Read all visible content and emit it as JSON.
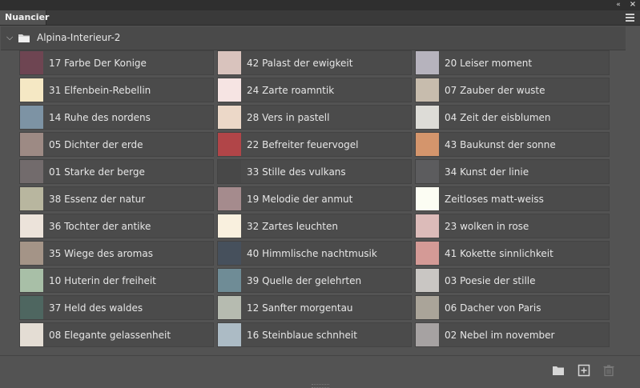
{
  "panel": {
    "tab_label": "Nuancier"
  },
  "group": {
    "name": "Alpina-Interieur-2"
  },
  "swatches": [
    [
      {
        "label": "17 Farbe Der Konige",
        "color": "#6e4552"
      },
      {
        "label": "42 Palast der ewigkeit",
        "color": "#d9c3bd"
      },
      {
        "label": "20 Leiser moment",
        "color": "#b6b3bd"
      }
    ],
    [
      {
        "label": "31 Elfenbein-Rebellin",
        "color": "#f5e8c4"
      },
      {
        "label": "24 Zarte roamntik",
        "color": "#f6e4e3"
      },
      {
        "label": "07 Zauber der wuste",
        "color": "#c7bcad"
      }
    ],
    [
      {
        "label": "14 Ruhe des nordens",
        "color": "#7d93a4"
      },
      {
        "label": "28 Vers in pastell",
        "color": "#ecd8c8"
      },
      {
        "label": "04 Zeit der eisblumen",
        "color": "#dddcd7"
      }
    ],
    [
      {
        "label": "05 Dichter der erde",
        "color": "#9d8a84"
      },
      {
        "label": "22 Befreiter feuervogel",
        "color": "#b14548"
      },
      {
        "label": "43 Baukunst der sonne",
        "color": "#d4956c"
      }
    ],
    [
      {
        "label": "01 Starke der berge",
        "color": "#726b6c"
      },
      {
        "label": "33 Stille des vulkans",
        "color": "#484848"
      },
      {
        "label": "34 Kunst der linie",
        "color": "#5c5c5e"
      }
    ],
    [
      {
        "label": "38 Essenz der natur",
        "color": "#b8b69f"
      },
      {
        "label": "19 Melodie der anmut",
        "color": "#a58b8d"
      },
      {
        "label": "Zeitloses matt-weiss",
        "color": "#fcfdf3"
      }
    ],
    [
      {
        "label": "36 Tochter der antike",
        "color": "#ece3da"
      },
      {
        "label": "32 Zartes leuchten",
        "color": "#f9f0de"
      },
      {
        "label": "23 wolken in rose",
        "color": "#dcbbb9"
      }
    ],
    [
      {
        "label": "35 Wiege des aromas",
        "color": "#a49487"
      },
      {
        "label": "40 Himmlische nachtmusik",
        "color": "#46505c"
      },
      {
        "label": "41 Kokette sinnlichkeit",
        "color": "#d49a96"
      }
    ],
    [
      {
        "label": "10 Huterin der freiheit",
        "color": "#a8bfa7"
      },
      {
        "label": "39 Quelle der gelehrten",
        "color": "#6f8c96"
      },
      {
        "label": "03 Poesie der stille",
        "color": "#c9c6c3"
      }
    ],
    [
      {
        "label": "37 Held des waldes",
        "color": "#4e6660"
      },
      {
        "label": "12 Sanfter morgentau",
        "color": "#b6bbb0"
      },
      {
        "label": "06 Dacher von Paris",
        "color": "#aaa499"
      }
    ],
    [
      {
        "label": "08 Elegante gelassenheit",
        "color": "#e4ddd4"
      },
      {
        "label": "16 Steinblaue schnheit",
        "color": "#acbbc5"
      },
      {
        "label": "02 Nebel im november",
        "color": "#a6a2a2"
      }
    ]
  ],
  "icons": {
    "collapse": "collapse-panel-icon",
    "close": "close-icon",
    "menu": "panel-menu-icon",
    "folder": "folder-icon",
    "new_group": "new-group-icon",
    "new_swatch": "new-swatch-icon",
    "delete": "trash-icon"
  }
}
